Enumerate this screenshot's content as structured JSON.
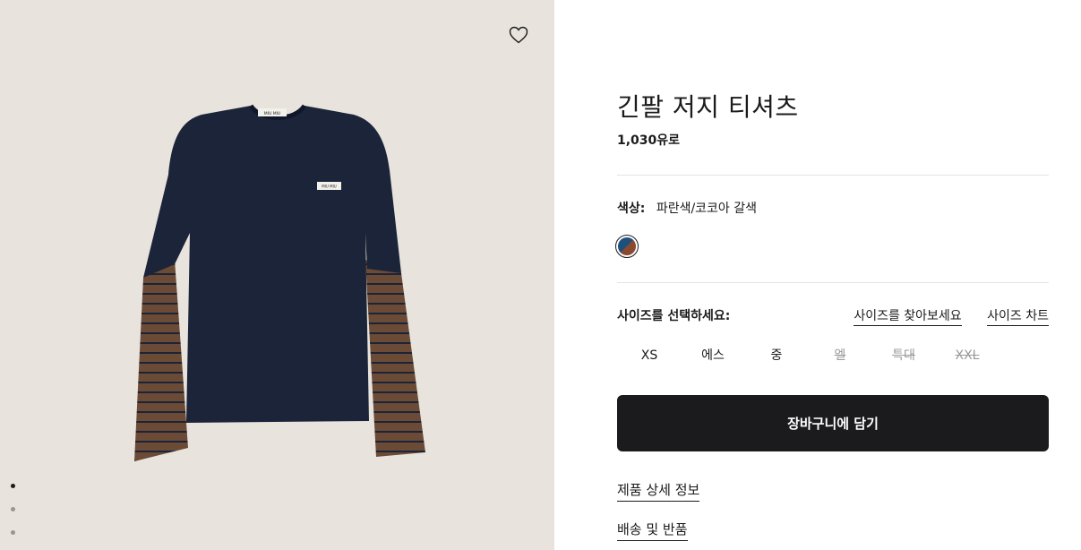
{
  "product": {
    "title": "긴팔 저지 티셔츠",
    "price": "1,030유로"
  },
  "color": {
    "label": "색상:",
    "value": "파란색/코코아 갈색",
    "swatch_colors": [
      "#1f4f7c",
      "#8a4a2f"
    ]
  },
  "size": {
    "label": "사이즈를 선택하세요:",
    "finder_link": "사이즈를 찾아보세요",
    "chart_link": "사이즈 차트",
    "options": [
      {
        "label": "XS",
        "available": true
      },
      {
        "label": "에스",
        "available": true
      },
      {
        "label": "중",
        "available": true
      },
      {
        "label": "엘",
        "available": false
      },
      {
        "label": "특대",
        "available": false
      },
      {
        "label": "XXL",
        "available": false
      }
    ]
  },
  "actions": {
    "add_to_cart": "장바구니에 담기"
  },
  "links": {
    "product_details": "제품 상세 정보",
    "shipping_returns": "배송 및 반품"
  },
  "gallery": {
    "wishlist_icon": "heart-icon",
    "image_count": 3,
    "active_index": 0,
    "image_label_text": "MIU MIU",
    "shirt_colors": {
      "body": "#1b2438",
      "sleeve": "#6b4a36",
      "stripe": "#1b2438"
    }
  }
}
